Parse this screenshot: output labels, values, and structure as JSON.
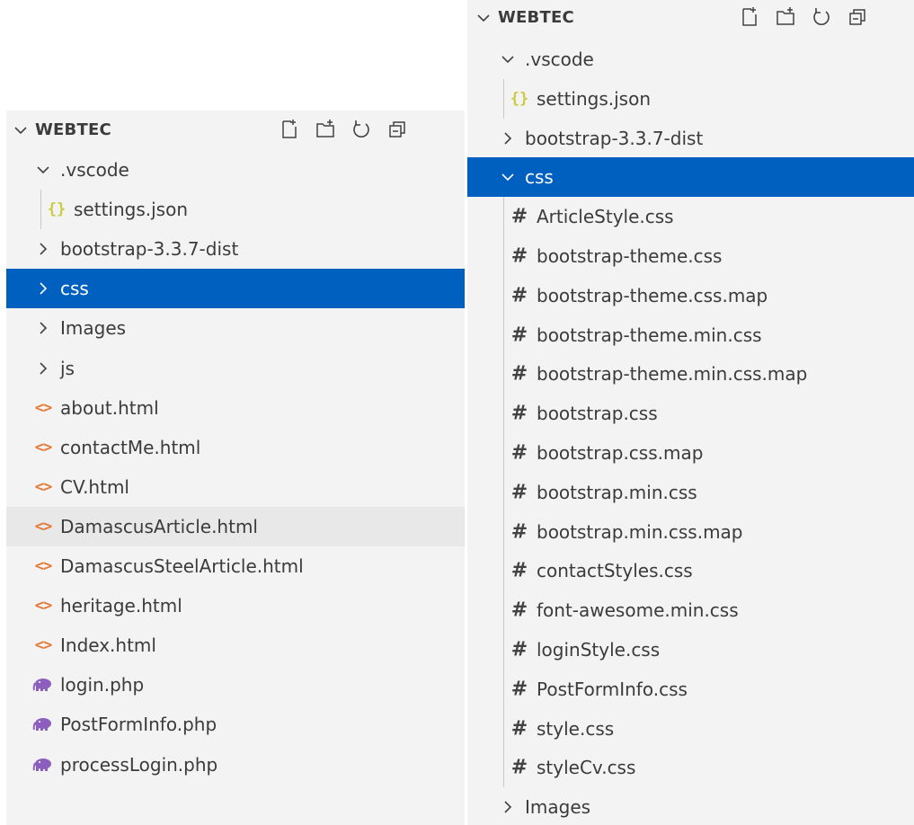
{
  "colors": {
    "selection": "#0060c0",
    "hover_row": "#e8e8e8",
    "pane_bg": "#f3f3f3",
    "html_icon": "#e37933",
    "json_icon": "#cbcb41",
    "php_icon": "#8c5fbf",
    "css_icon": "#424242"
  },
  "left_panel": {
    "title": "WEBTEC",
    "actions": [
      "new-file-icon",
      "new-folder-icon",
      "refresh-icon",
      "collapse-all-icon"
    ],
    "items": [
      {
        "label": ".vscode",
        "kind": "folder",
        "expanded": true,
        "depth": 0
      },
      {
        "label": "settings.json",
        "kind": "json",
        "depth": 1
      },
      {
        "label": "bootstrap-3.3.7-dist",
        "kind": "folder",
        "expanded": false,
        "depth": 0
      },
      {
        "label": "css",
        "kind": "folder",
        "expanded": false,
        "depth": 0,
        "selected": true
      },
      {
        "label": "Images",
        "kind": "folder",
        "expanded": false,
        "depth": 0
      },
      {
        "label": "js",
        "kind": "folder",
        "expanded": false,
        "depth": 0
      },
      {
        "label": "about.html",
        "kind": "html",
        "depth": 0
      },
      {
        "label": "contactMe.html",
        "kind": "html",
        "depth": 0
      },
      {
        "label": "CV.html",
        "kind": "html",
        "depth": 0
      },
      {
        "label": "DamascusArticle.html",
        "kind": "html",
        "depth": 0,
        "hover": true
      },
      {
        "label": "DamascusSteelArticle.html",
        "kind": "html",
        "depth": 0
      },
      {
        "label": "heritage.html",
        "kind": "html",
        "depth": 0
      },
      {
        "label": "Index.html",
        "kind": "html",
        "depth": 0
      },
      {
        "label": "login.php",
        "kind": "php",
        "depth": 0
      },
      {
        "label": "PostFormInfo.php",
        "kind": "php",
        "depth": 0
      },
      {
        "label": "processLogin.php",
        "kind": "php",
        "depth": 0
      }
    ]
  },
  "right_panel": {
    "title": "WEBTEC",
    "actions": [
      "new-file-icon",
      "new-folder-icon",
      "refresh-icon",
      "collapse-all-icon"
    ],
    "items": [
      {
        "label": ".vscode",
        "kind": "folder",
        "expanded": true,
        "depth": 0
      },
      {
        "label": "settings.json",
        "kind": "json",
        "depth": 1
      },
      {
        "label": "bootstrap-3.3.7-dist",
        "kind": "folder",
        "expanded": false,
        "depth": 0
      },
      {
        "label": "css",
        "kind": "folder",
        "expanded": true,
        "depth": 0,
        "selected": true
      },
      {
        "label": "ArticleStyle.css",
        "kind": "css",
        "depth": 1
      },
      {
        "label": "bootstrap-theme.css",
        "kind": "css",
        "depth": 1
      },
      {
        "label": "bootstrap-theme.css.map",
        "kind": "css",
        "depth": 1
      },
      {
        "label": "bootstrap-theme.min.css",
        "kind": "css",
        "depth": 1
      },
      {
        "label": "bootstrap-theme.min.css.map",
        "kind": "css",
        "depth": 1
      },
      {
        "label": "bootstrap.css",
        "kind": "css",
        "depth": 1
      },
      {
        "label": "bootstrap.css.map",
        "kind": "css",
        "depth": 1
      },
      {
        "label": "bootstrap.min.css",
        "kind": "css",
        "depth": 1
      },
      {
        "label": "bootstrap.min.css.map",
        "kind": "css",
        "depth": 1
      },
      {
        "label": "contactStyles.css",
        "kind": "css",
        "depth": 1
      },
      {
        "label": "font-awesome.min.css",
        "kind": "css",
        "depth": 1
      },
      {
        "label": "loginStyle.css",
        "kind": "css",
        "depth": 1
      },
      {
        "label": "PostFormInfo.css",
        "kind": "css",
        "depth": 1
      },
      {
        "label": "style.css",
        "kind": "css",
        "depth": 1
      },
      {
        "label": "styleCv.css",
        "kind": "css",
        "depth": 1
      },
      {
        "label": "Images",
        "kind": "folder",
        "expanded": false,
        "depth": 0
      }
    ]
  }
}
